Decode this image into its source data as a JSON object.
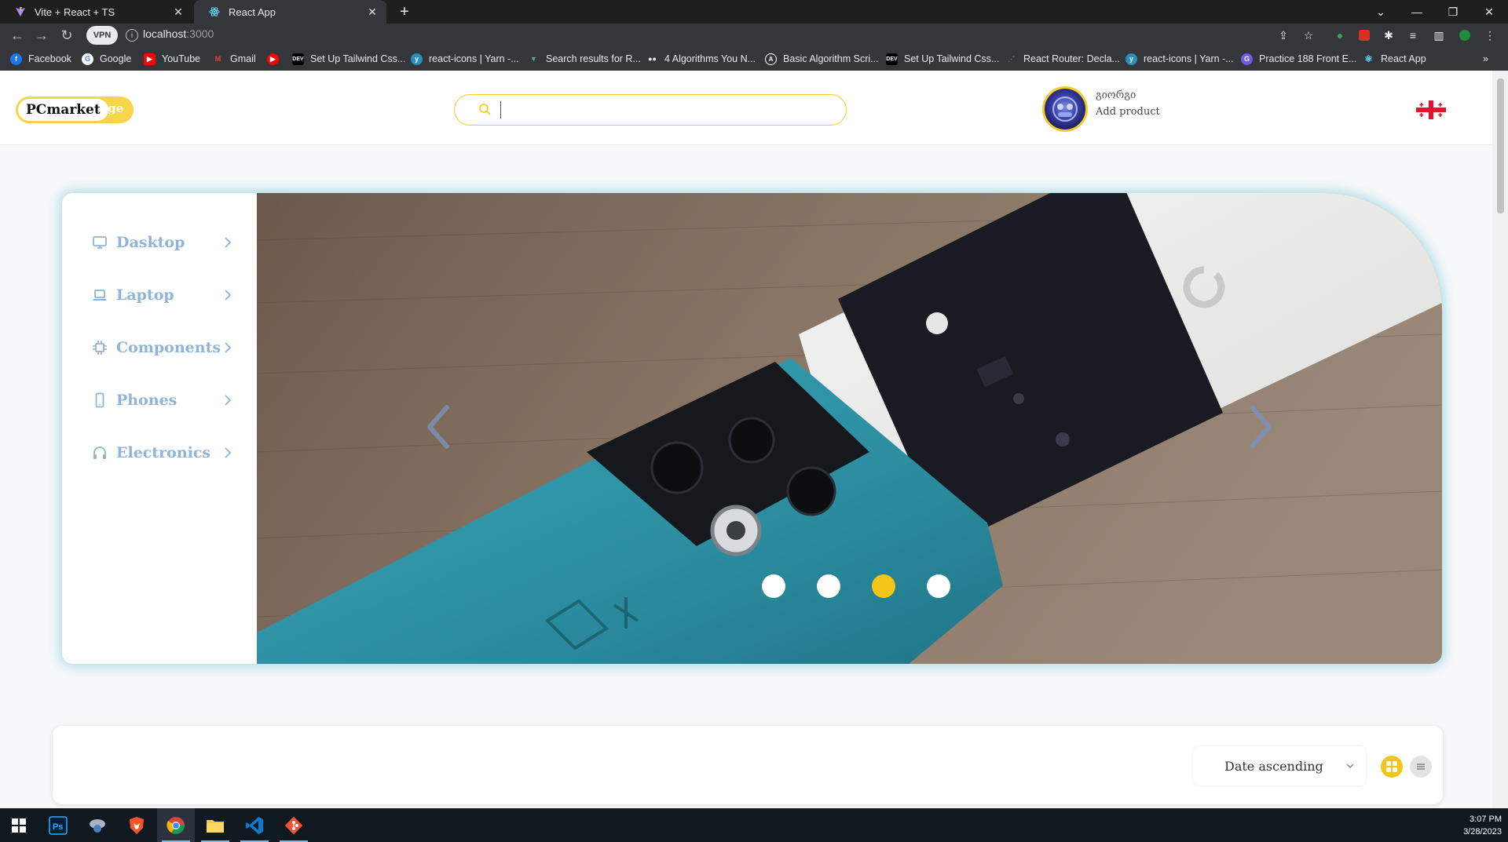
{
  "browser": {
    "tabs": [
      {
        "title": "Vite + React + TS",
        "active": false,
        "icon": "vite-icon"
      },
      {
        "title": "React App",
        "active": true,
        "icon": "react-icon"
      }
    ],
    "new_tab": "+",
    "url_host": "localhost",
    "url_port": ":3000",
    "vpn_label": "VPN",
    "bookmarks": [
      {
        "label": "Facebook",
        "icon": "facebook-icon"
      },
      {
        "label": "Google",
        "icon": "google-icon"
      },
      {
        "label": "YouTube",
        "icon": "youtube-icon"
      },
      {
        "label": "Gmail",
        "icon": "gmail-icon"
      },
      {
        "label": "",
        "icon": "youtube-red-icon"
      },
      {
        "label": "Set Up Tailwind Css...",
        "icon": "dev-icon"
      },
      {
        "label": "react-icons | Yarn -...",
        "icon": "yarn-icon"
      },
      {
        "label": "Search results for R...",
        "icon": "vue-icon"
      },
      {
        "label": "4 Algorithms You N...",
        "icon": "medium-icon"
      },
      {
        "label": "Basic Algorithm Scri...",
        "icon": "fcc-icon"
      },
      {
        "label": "Set Up Tailwind Css...",
        "icon": "dev-icon"
      },
      {
        "label": "React Router: Decla...",
        "icon": "react-router-icon"
      },
      {
        "label": "react-icons | Yarn -...",
        "icon": "yarn-icon"
      },
      {
        "label": "Practice 188 Front E...",
        "icon": "greatfrontend-icon"
      },
      {
        "label": "React App",
        "icon": "react-icon"
      }
    ]
  },
  "header": {
    "logo_main": "PCmarket",
    "logo_suffix": ".ge",
    "search_placeholder": "",
    "username": "გიორგი",
    "add_product": "Add product",
    "brand_color": "#f4cd2c"
  },
  "categories": [
    {
      "label": "Dasktop",
      "icon": "desktop-icon"
    },
    {
      "label": "Laptop",
      "icon": "laptop-icon"
    },
    {
      "label": "Components",
      "icon": "components-icon"
    },
    {
      "label": "Phones",
      "icon": "phone-icon"
    },
    {
      "label": "Electronics",
      "icon": "headphones-icon"
    }
  ],
  "carousel": {
    "slide_count": 4,
    "active_index": 2,
    "active_color": "#f4c519"
  },
  "filter": {
    "sort_value": "Date ascending",
    "view_modes": [
      "grid",
      "list"
    ],
    "active_view": "grid"
  },
  "taskbar": {
    "time": "3:07 PM",
    "date": "3/28/2023",
    "apps": [
      "windows-start-icon",
      "photoshop-icon",
      "app-icon",
      "brave-icon",
      "chrome-icon",
      "file-explorer-icon",
      "vscode-icon",
      "git-icon"
    ]
  }
}
